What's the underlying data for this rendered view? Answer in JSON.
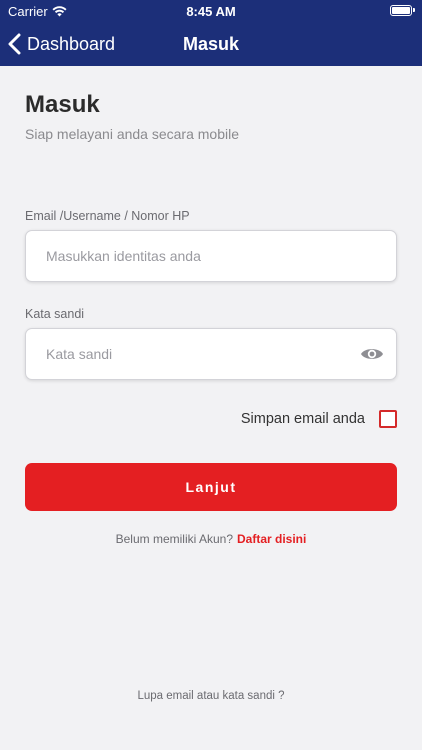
{
  "status_bar": {
    "carrier": "Carrier",
    "time": "8:45 AM",
    "wifi_icon": "wifi-icon",
    "battery_icon": "battery-icon",
    "battery_level_percent": 100
  },
  "nav": {
    "back_label": "Dashboard",
    "back_icon": "chevron-left-icon",
    "title": "Masuk",
    "background_color": "#1c2f79"
  },
  "header": {
    "title": "Masuk",
    "subtitle": "Siap melayani anda secara mobile"
  },
  "form": {
    "identity": {
      "label": "Email /Username / Nomor HP",
      "placeholder": "Masukkan identitas anda",
      "value": ""
    },
    "password": {
      "label": "Kata sandi",
      "placeholder": "Kata sandi",
      "value": "",
      "toggle_icon": "eye-icon"
    },
    "remember": {
      "label": "Simpan email anda",
      "checked": false
    },
    "submit_label": "Lanjut",
    "accent_color": "#e41f22"
  },
  "register": {
    "prompt": "Belum memiliki Akun?",
    "link": "Daftar disini"
  },
  "forgot_label": "Lupa email atau kata sandi ?"
}
